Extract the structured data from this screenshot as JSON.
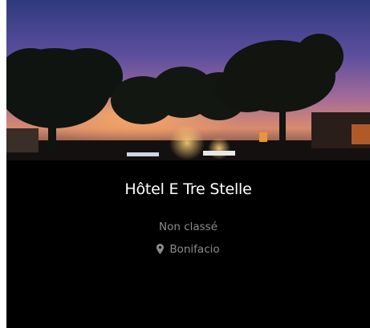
{
  "hotel": {
    "name": "Hôtel E Tre Stelle",
    "rating": "Non classé",
    "location": "Bonifacio"
  },
  "icons": {
    "location": "map-marker-icon"
  },
  "colors": {
    "card_background": "#000000",
    "title_text": "#ffffff",
    "secondary_text": "#8c8c8c"
  }
}
